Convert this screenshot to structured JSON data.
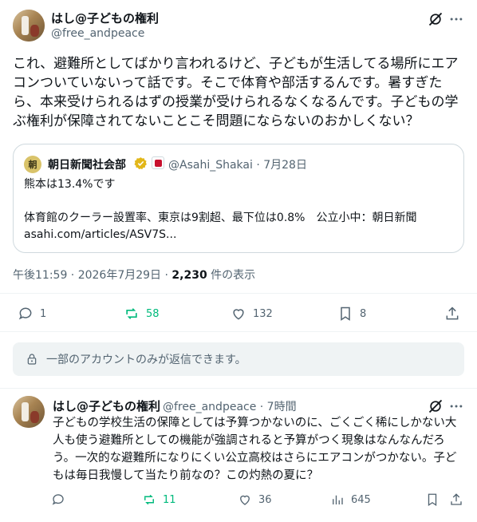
{
  "main_post": {
    "author_name": "はし@子どもの権利",
    "author_handle": "@free_andpeace",
    "text": "これ、避難所としてばかり言われるけど、子どもが生活してる場所にエアコンついていないって話です。そこで体育や部活するんです。暑すぎたら、本来受けられるはずの授業が受けられるなくなるんです。子どもの学ぶ権利が保障されてないことこそ問題にならないのおかしくない？",
    "quote": {
      "logo_char": "朝",
      "name": "朝日新聞社会部",
      "handle_date": "@Asahi_Shakai · 7月28日",
      "line1": "熊本は13.4%です",
      "line2": "体育館のクーラー設置率、東京は9割超、最下位は0.8%　公立小中：朝日新聞",
      "line3": "asahi.com/articles/ASV7S..."
    },
    "timestamp": "午後11:59 · 2026年7月29日 · ",
    "views_count": "2,230",
    "views_label": " 件の表示",
    "stats": {
      "replies": "1",
      "reposts": "58",
      "likes": "132",
      "bookmarks": "8"
    }
  },
  "reply_restriction": "一部のアカウントのみが返信できます。",
  "reply_post": {
    "author_name": "はし@子どもの権利",
    "handle_time": "@free_andpeace · 7時間",
    "text": "子どもの学校生活の保障としては予算つかないのに、ごくごく稀にしかない大人も使う避難所としての機能が強調されると予算がつく現象はなんなんだろう。一次的な避難所になりにくい公立高校はさらにエアコンがつかない。子どもは毎日我慢して当たり前なの？この灼熱の夏に？",
    "stats": {
      "replies": "",
      "reposts": "11",
      "likes": "36",
      "views": "645"
    }
  },
  "colors": {
    "text_primary": "#0f1419",
    "text_secondary": "#536471",
    "repost_green": "#00ba7c",
    "border": "#cfd9de",
    "verified_gold": "#e2b719"
  },
  "icons": [
    "grok-icon",
    "more-icon",
    "reply-icon",
    "repost-icon",
    "like-icon",
    "bookmark-icon",
    "share-icon",
    "lock-icon",
    "views-icon",
    "verified-badge-icon"
  ]
}
